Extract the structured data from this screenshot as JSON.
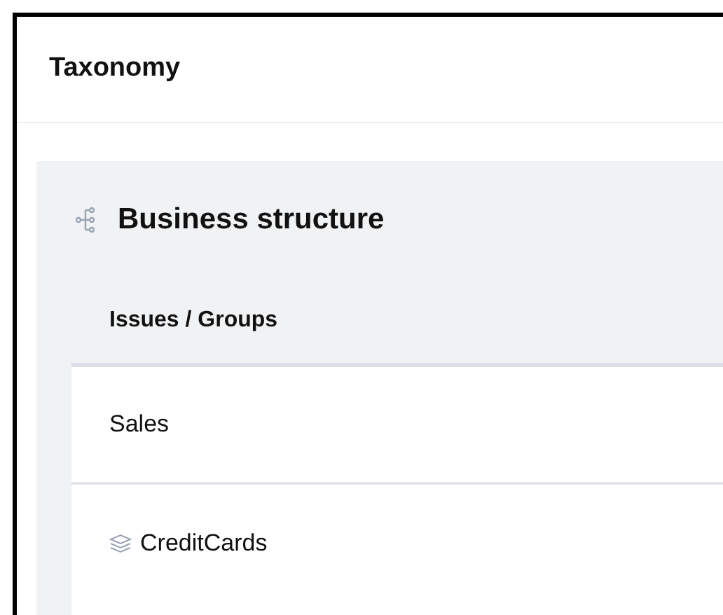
{
  "title": "Taxonomy",
  "section": {
    "title": "Business structure",
    "column_header": "Issues / Groups",
    "rows": [
      {
        "label": "Sales",
        "kind": "issue"
      },
      {
        "label": "CreditCards",
        "kind": "group"
      }
    ]
  }
}
